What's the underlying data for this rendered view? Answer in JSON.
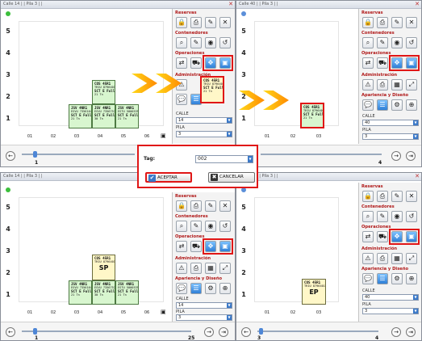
{
  "windows": [
    {
      "id": "tl",
      "title": "Calle 14 | | Pila 3 | |",
      "dot": "#3cbf3c",
      "y_labels": [
        "5",
        "4",
        "3",
        "2",
        "1"
      ],
      "x_labels": [
        "01",
        "02",
        "03",
        "04",
        "05",
        "06"
      ],
      "calle": "14",
      "pila": "3",
      "slider_min": "1",
      "slider_max": "25"
    },
    {
      "id": "tr",
      "title": "Calle 40 | | Pila 3 | |",
      "dot": "#5b8fd9",
      "y_labels": [
        "5",
        "4",
        "3",
        "2",
        "1"
      ],
      "x_labels": [
        "01",
        "02",
        "03"
      ],
      "calle": "40",
      "pila": "3",
      "slider_min": "3",
      "slider_max": "4"
    },
    {
      "id": "bl",
      "title": "Calle 14 | | Pila 3 | |",
      "dot": "#3cbf3c",
      "y_labels": [
        "5",
        "4",
        "3",
        "2",
        "1"
      ],
      "x_labels": [
        "01",
        "02",
        "03",
        "04",
        "05",
        "06"
      ],
      "calle": "14",
      "pila": "3",
      "slider_min": "1",
      "slider_max": "25"
    },
    {
      "id": "br",
      "title": "Calle 40 | | Pila 3 | |",
      "dot": "#5b8fd9",
      "y_labels": [
        "5",
        "4",
        "3",
        "2",
        "1"
      ],
      "x_labels": [
        "01",
        "02",
        "03"
      ],
      "calle": "40",
      "pila": "3",
      "slider_min": "3",
      "slider_max": "4"
    }
  ],
  "panel": {
    "sections": [
      "Reservas",
      "Contenedores",
      "Operaciones",
      "Administración",
      "Apariencia y Diseño"
    ],
    "calle_label": "CALLE",
    "pila_label": "PILA"
  },
  "containers": {
    "c1": {
      "l1": "JSV 4NR1",
      "l2": "ESVU 7356164",
      "l3": "SCT E Full",
      "l4": "21 Tn"
    },
    "c2": {
      "l1": "JSV 4NR1",
      "l2": "ESVU 7356757",
      "l3": "SCT E Full",
      "l4": "30 Tn"
    },
    "c3": {
      "l1": "JSV 4NR1",
      "l2": "ESTU 5000539",
      "l3": "SCT E Full",
      "l4": "21 Tn"
    },
    "top": {
      "l1": "COS 45R1",
      "l2": "TRIU 8796401",
      "l3": "SCT E Full",
      "l4": "21 Tn"
    },
    "sp_tag": "SP",
    "ep_tag": "EP"
  },
  "dialog": {
    "tag_label": "Tag:",
    "tag_value": "002",
    "accept": "ACEPTAR",
    "cancel": "CANCELAR"
  },
  "colors": {
    "accent": "#e01616",
    "container": "#d8f6cf",
    "selected": "#fff7c8",
    "arrow": "#ffb400"
  }
}
